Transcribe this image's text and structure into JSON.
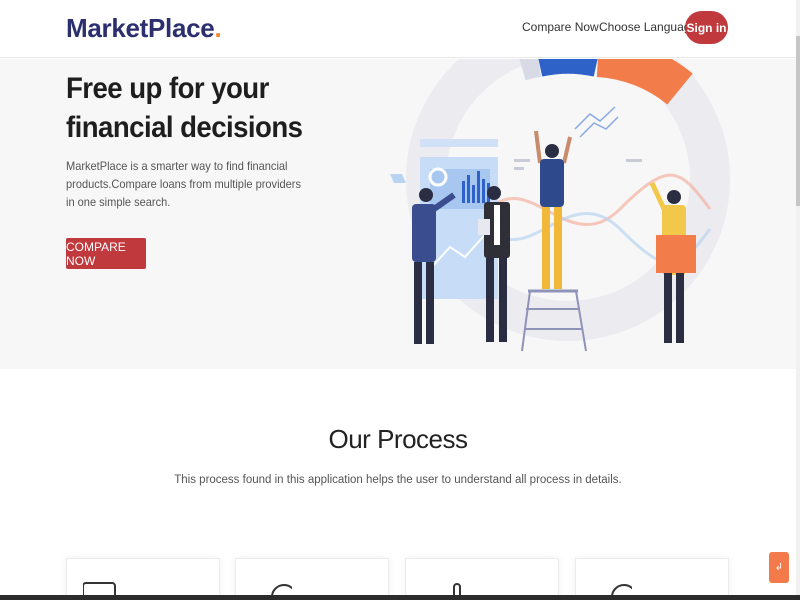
{
  "header": {
    "logo": {
      "brand": "MarketPlace",
      "dot": "."
    },
    "nav": {
      "compare": "Compare Now",
      "language": "Choose Language"
    },
    "signin": "Sign in"
  },
  "hero": {
    "title_line1": "Free up for your",
    "title_line2": "financial decisions",
    "description": "MarketPlace is a smarter way to find financial products.Compare loans from multiple providers in one simple search.",
    "button": "COMPARE NOW",
    "illustration_icon": "business-team-analytics-illustration"
  },
  "process": {
    "title": "Our Process",
    "subtitle": "This process found in this application helps the user to understand all process in details."
  },
  "cards": [
    {
      "icon": "laptop-icon"
    },
    {
      "icon": "search-icon"
    },
    {
      "icon": "thermometer-icon"
    },
    {
      "icon": "search-icon"
    }
  ],
  "float_button_icon": "scroll-top-arrow-icon",
  "colors": {
    "brand_navy": "#2b2f6e",
    "brand_orange": "#f0892f",
    "primary_red": "#c0393d",
    "hero_bg": "#f7f7f7",
    "float_orange": "#f37a4a"
  }
}
